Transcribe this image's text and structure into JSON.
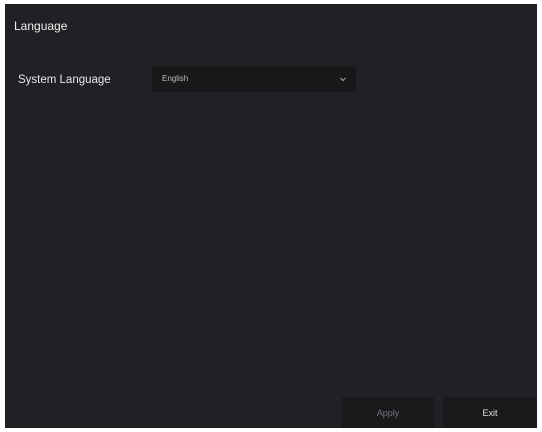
{
  "page": {
    "title": "Language"
  },
  "system_language": {
    "label": "System Language",
    "selected": "English",
    "dropdown_icon": "chevron-down-icon"
  },
  "footer": {
    "apply_label": "Apply",
    "exit_label": "Exit"
  },
  "colors": {
    "background": "#212125",
    "control_background": "#18181b",
    "disabled_text": "#75757a",
    "text": "#e8e8e8"
  }
}
